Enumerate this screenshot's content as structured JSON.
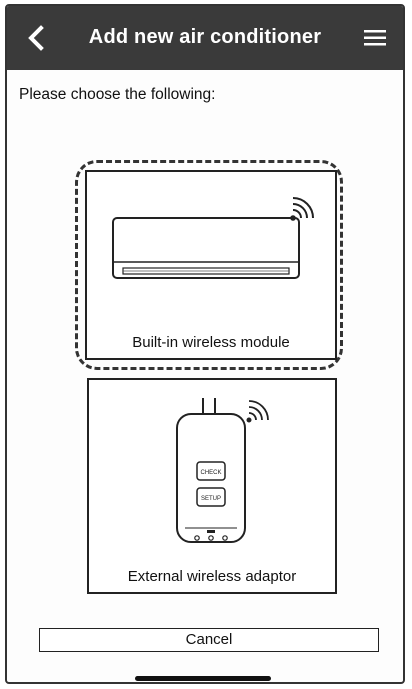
{
  "header": {
    "title": "Add new air conditioner",
    "back_icon": "chevron-left-icon",
    "menu_icon": "hamburger-menu-icon"
  },
  "prompt": "Please choose the following:",
  "options": [
    {
      "label": "Built-in wireless module",
      "icon": "air-conditioner-wifi-icon",
      "selected": true
    },
    {
      "label": "External wireless adaptor",
      "icon": "wireless-adaptor-icon",
      "selected": false
    }
  ],
  "adaptor": {
    "button_top": "CHECK",
    "button_bottom": "SETUP"
  },
  "cancel_label": "Cancel",
  "colors": {
    "header_bg": "#3a3a3a",
    "header_text": "#ffffff",
    "border": "#222222"
  }
}
